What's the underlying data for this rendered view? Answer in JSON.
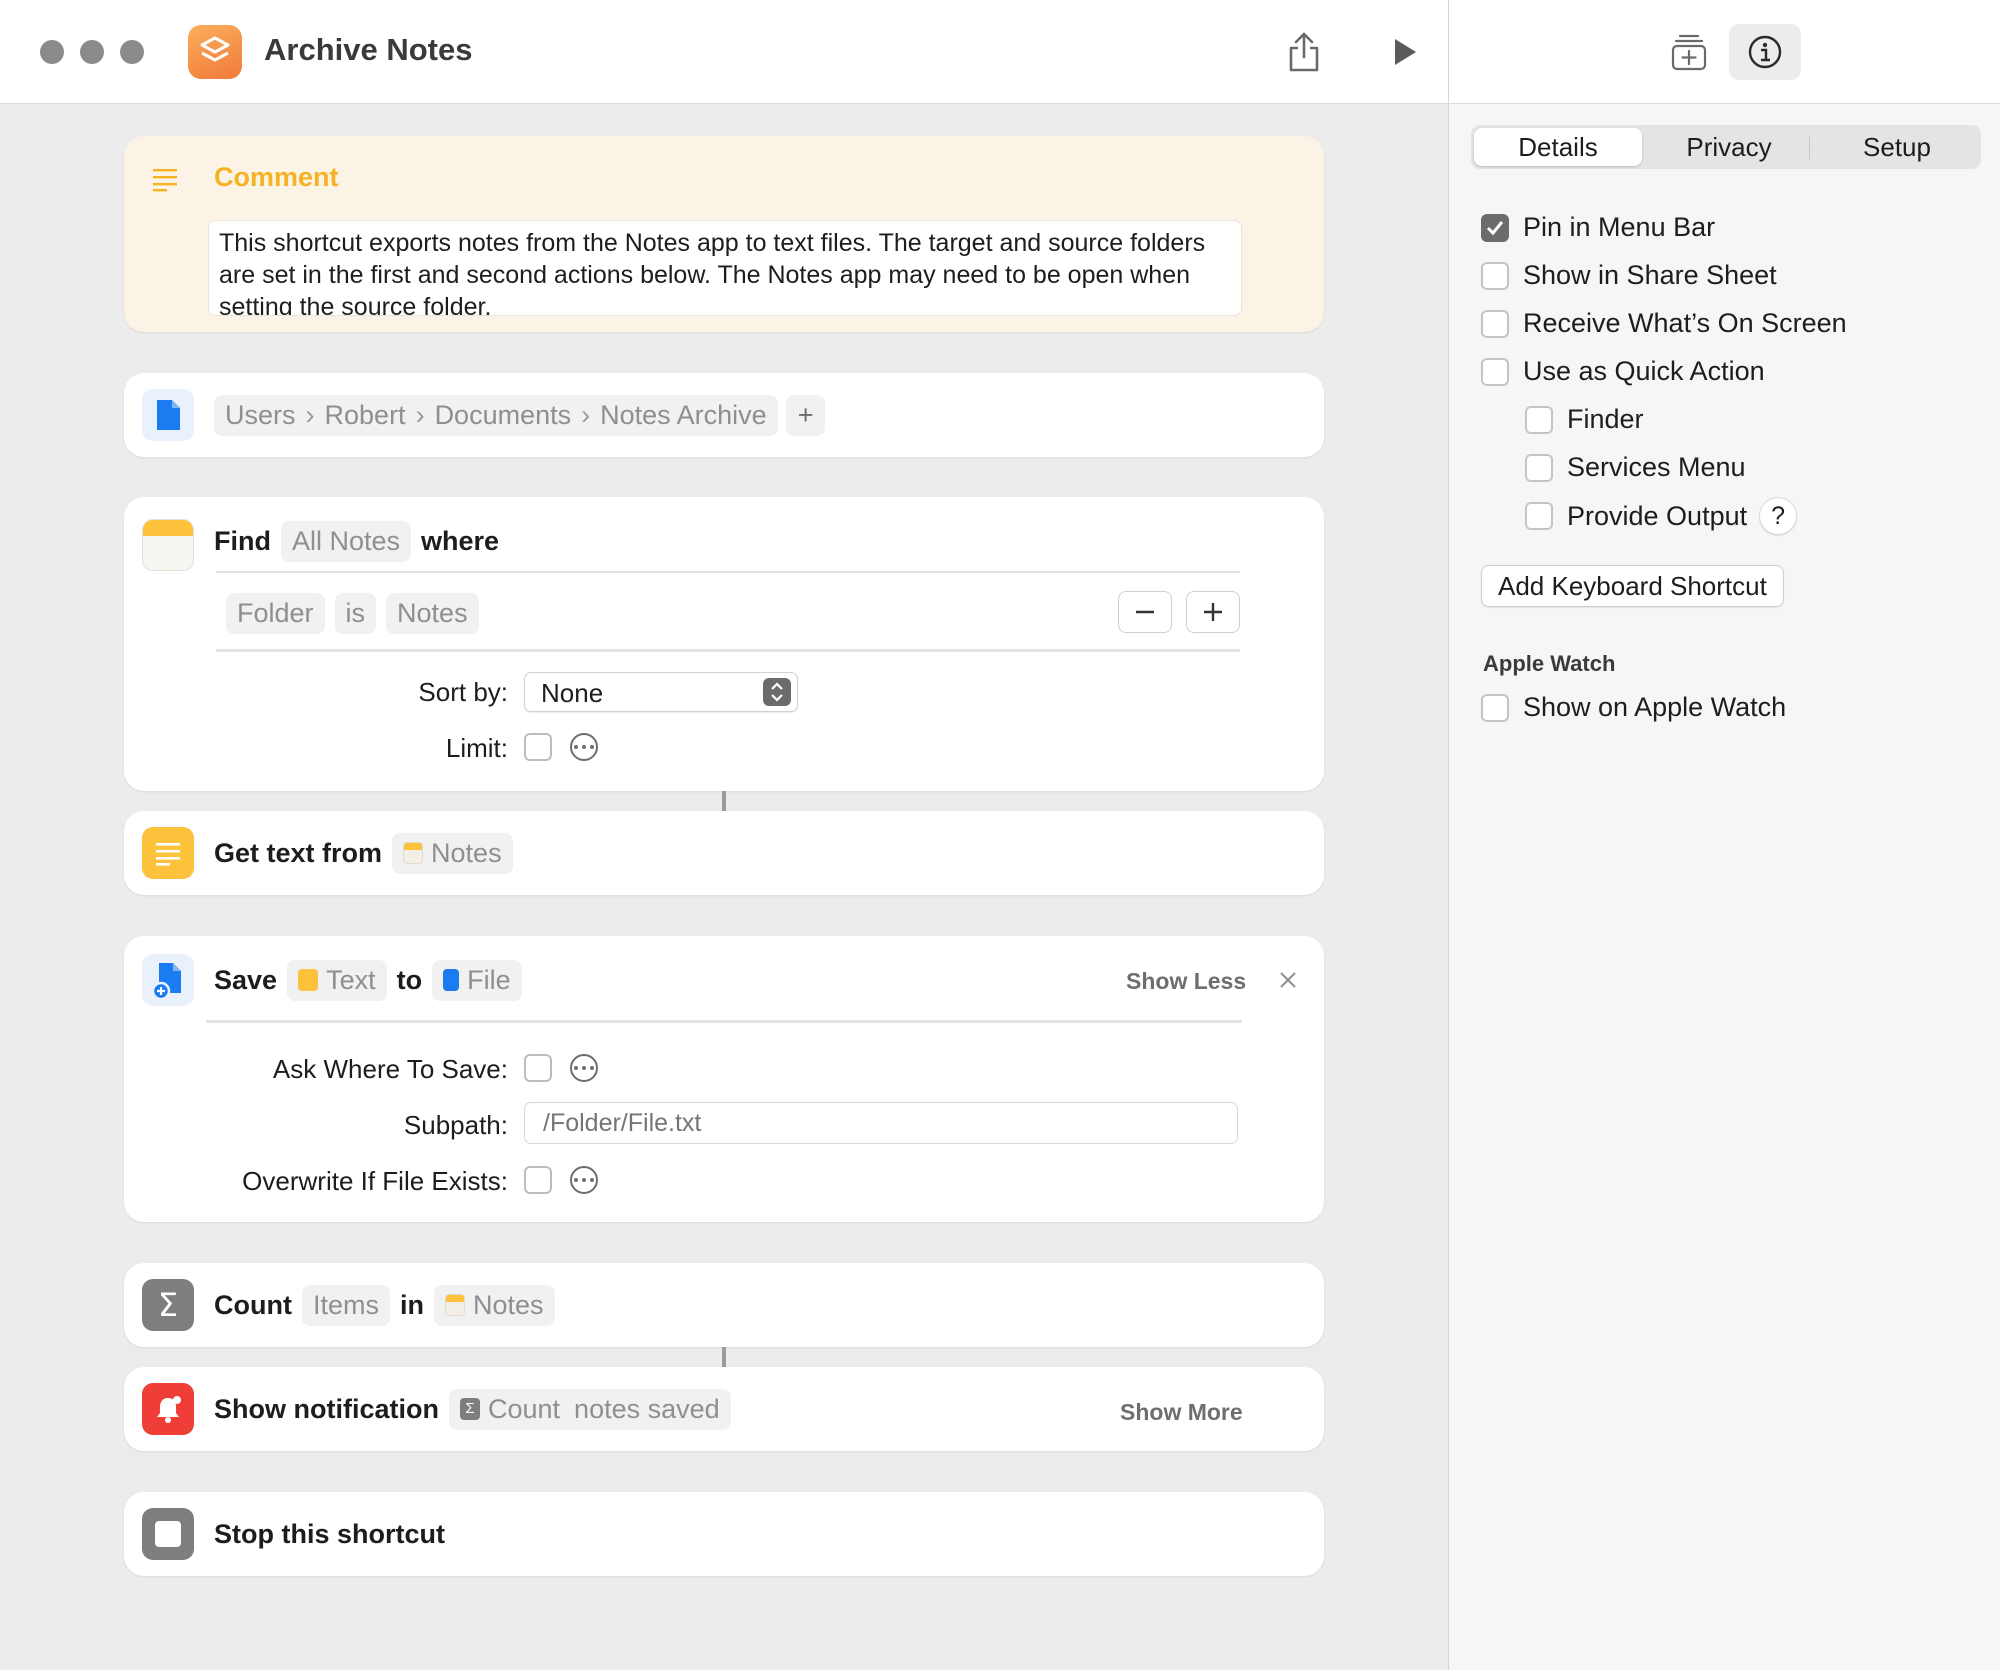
{
  "window": {
    "title": "Archive Notes"
  },
  "comment": {
    "title": "Comment",
    "text": "This shortcut exports notes from the Notes app to text files. The target and source folders are set in the first and second actions below. The Notes app may need to be open when setting the source folder."
  },
  "path_action": {
    "segments": [
      "Users",
      "Robert",
      "Documents",
      "Notes Archive"
    ],
    "add_label": "+"
  },
  "find_action": {
    "verb": "Find",
    "target": "All Notes",
    "where_label": "where",
    "filter": {
      "field": "Folder",
      "operator": "is",
      "value": "Notes"
    },
    "sort_label": "Sort by:",
    "sort_value": "None",
    "limit_label": "Limit:"
  },
  "gettext_action": {
    "label": "Get text from",
    "source": "Notes"
  },
  "save_action": {
    "verb": "Save",
    "input": "Text",
    "to_label": "to",
    "destination": "File",
    "toggle_label": "Show Less",
    "ask_label": "Ask Where To Save:",
    "subpath_label": "Subpath:",
    "subpath_placeholder": "/Folder/File.txt",
    "overwrite_label": "Overwrite If File Exists:"
  },
  "count_action": {
    "verb": "Count",
    "what": "Items",
    "in_label": "in",
    "source": "Notes"
  },
  "notify_action": {
    "label": "Show notification",
    "var": "Count",
    "text": "notes saved",
    "toggle_label": "Show More"
  },
  "stop_action": {
    "label": "Stop this shortcut"
  },
  "panel": {
    "tabs": [
      "Details",
      "Privacy",
      "Setup"
    ],
    "active_tab": "Details",
    "options": [
      {
        "label": "Pin in Menu Bar",
        "checked": true
      },
      {
        "label": "Show in Share Sheet",
        "checked": false
      },
      {
        "label": "Receive What’s On Screen",
        "checked": false
      },
      {
        "label": "Use as Quick Action",
        "checked": false
      }
    ],
    "sub_options": [
      {
        "label": "Finder",
        "checked": false
      },
      {
        "label": "Services Menu",
        "checked": false
      },
      {
        "label": "Provide Output",
        "checked": false
      }
    ],
    "help_label": "?",
    "keyboard_button": "Add Keyboard Shortcut",
    "watch_heading": "Apple Watch",
    "watch_option": {
      "label": "Show on Apple Watch",
      "checked": false
    }
  },
  "colors": {
    "comment_accent": "#f5b324",
    "file_blue": "#1a7cf0",
    "notes_yellow": "#fcc23b",
    "notify_red": "#ee3e37",
    "count_gray": "#7e7e7e"
  }
}
